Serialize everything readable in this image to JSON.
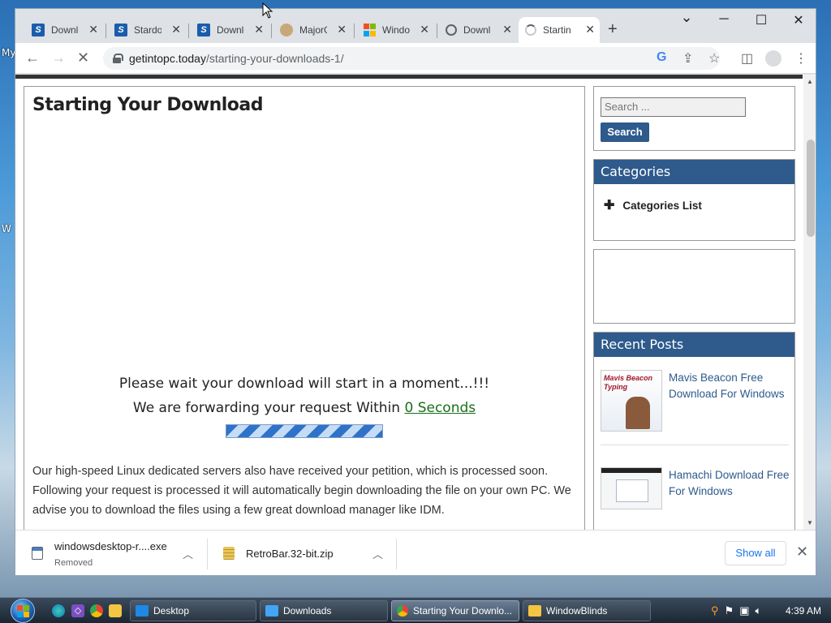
{
  "desktop": {
    "labels": [
      "My",
      "W"
    ]
  },
  "browser": {
    "tabs": [
      {
        "title": "Downlo",
        "favicon": "stardock-icon"
      },
      {
        "title": "Stardoc",
        "favicon": "stardock-icon"
      },
      {
        "title": "Downlo",
        "favicon": "stardock-icon"
      },
      {
        "title": "MajorG",
        "favicon": "majorgeeks-icon"
      },
      {
        "title": "Windo",
        "favicon": "windows-logo-icon"
      },
      {
        "title": "Downlo",
        "favicon": "globe-icon"
      },
      {
        "title": "Startin",
        "favicon": "loading-spinner-icon",
        "active": true
      }
    ],
    "new_tab": "+",
    "window_controls": {
      "minimize": "─",
      "maximize": "☐",
      "close": "✕",
      "tab_search": "⌄"
    },
    "url_host": "getintopc.today",
    "url_path": "/starting-your-downloads-1/"
  },
  "page": {
    "title": "Starting Your Download",
    "wait_line1": "Please wait your download will start in a moment...!!!",
    "wait_line2_prefix": "We are forwarding your request Within ",
    "wait_seconds": "0 Seconds",
    "body": "Our high-speed Linux dedicated servers also have received your petition, which is processed soon. Following your request is processed it will automatically begin downloading the file on your own PC. We advise you to download the files using a few great download manager like IDM.",
    "sidebar": {
      "search_placeholder": "Search ...",
      "search_button": "Search",
      "categories_heading": "Categories",
      "categories_item": "Categories List",
      "recent_heading": "Recent Posts",
      "posts": [
        {
          "title": "Mavis Beacon Free Download For Windows",
          "thumb_text": "Mavis Beacon Typing"
        },
        {
          "title": "Hamachi Download Free For Windows"
        }
      ]
    }
  },
  "downloads": {
    "items": [
      {
        "name": "windowsdesktop-r....exe",
        "status": "Removed"
      },
      {
        "name": "RetroBar.32-bit.zip",
        "status": ""
      }
    ],
    "show_all": "Show all",
    "close": "✕"
  },
  "taskbar": {
    "buttons": [
      {
        "label": "Desktop",
        "icon_color": "#1e88e5"
      },
      {
        "label": "Downloads",
        "icon_color": "#42a5f5"
      },
      {
        "label": "Starting Your Downlo...",
        "icon_color": "#ea4335",
        "active": true
      },
      {
        "label": "WindowBlinds",
        "icon_color": "#f4c542"
      }
    ],
    "clock": "4:39 AM"
  },
  "colors": {
    "accent": "#2e5a8c",
    "link_green": "#1a6f1a",
    "chrome_frame": "#dee1e6"
  }
}
